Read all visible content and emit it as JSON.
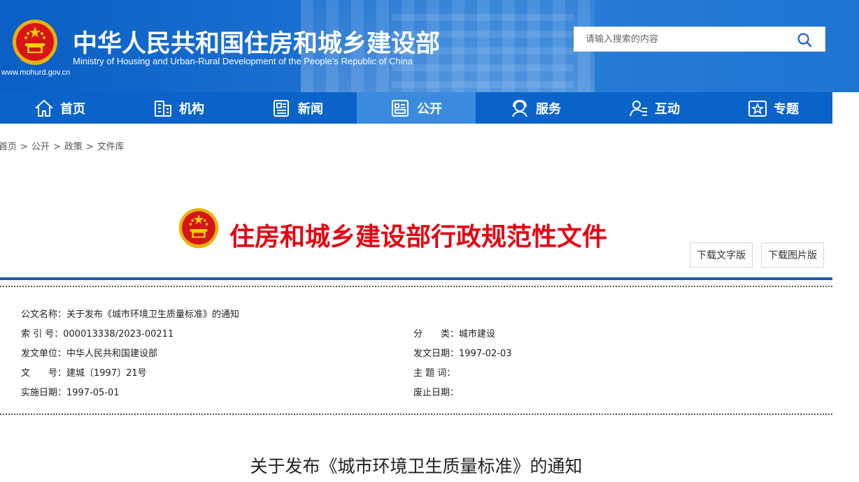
{
  "header": {
    "site_url": "www.mohurd.gov.cn",
    "title_cn": "中华人民共和国住房和城乡建设部",
    "title_en": "Ministry of Housing and Urban-Rural Development of the People’s Republic of China",
    "search_placeholder": "请输入搜索的内容",
    "colors": {
      "banner": "#0a5fc4",
      "nav": "#0a63c9",
      "nav_active": "#3a8be0"
    }
  },
  "nav": {
    "items": [
      {
        "label": "首页",
        "icon": "home-icon",
        "active": false
      },
      {
        "label": "机构",
        "icon": "building-icon",
        "active": false
      },
      {
        "label": "新闻",
        "icon": "news-icon",
        "active": false
      },
      {
        "label": "公开",
        "icon": "public-icon",
        "active": true
      },
      {
        "label": "服务",
        "icon": "service-icon",
        "active": false
      },
      {
        "label": "互动",
        "icon": "interact-icon",
        "active": false
      },
      {
        "label": "专题",
        "icon": "topic-icon",
        "active": false
      }
    ]
  },
  "breadcrumb": {
    "items": [
      "首页",
      "公开",
      "政策",
      "文件库"
    ],
    "separator": ">"
  },
  "document": {
    "heading": "住房和城乡建设部行政规范性文件",
    "heading_color": "#e60012",
    "download_text_label": "下载文字版",
    "download_image_label": "下载图片版",
    "meta": {
      "name_label": "公文名称：",
      "name_value": "关于发布《城市环境卫生质量标准》的通知",
      "index_label": "索 引 号：",
      "index_value": "000013338/2023-00211",
      "category_label": "分　　类：",
      "category_value": "城市建设",
      "issuer_label": "发文单位：",
      "issuer_value": "中华人民共和国建设部",
      "issue_date_label": "发文日期：",
      "issue_date_value": "1997-02-03",
      "doc_no_label": "文　　号：",
      "doc_no_value": "建城〔1997〕21号",
      "keywords_label": "主 题 词：",
      "keywords_value": "",
      "effective_label": "实施日期：",
      "effective_value": "1997-05-01",
      "repeal_label": "废止日期：",
      "repeal_value": ""
    },
    "article_title": "关于发布《城市环境卫生质量标准》的通知"
  }
}
